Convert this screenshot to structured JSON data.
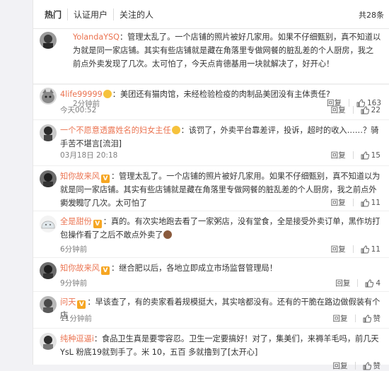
{
  "tabs": [
    {
      "label": "热门",
      "active": true
    },
    {
      "label": "认证用户",
      "active": false
    },
    {
      "label": "关注的人",
      "active": false
    }
  ],
  "total_count": "共28条",
  "comments": [
    {
      "user": "YolandaYSQ",
      "text": "：管理太乱了。一个店铺的照片被好几家用。如果不仔细甄别，真不知道以为就是同一家店铺。其实有些店铺就是藏在角落里专做网餐的脏乱差的个人厨房，我之前点外卖发现了几次。太可怕了，今天点肯德基用一块就解决了，好开心！",
      "time": "2分钟前",
      "reply": "回复",
      "likes": "163"
    },
    {
      "user": "4life99999",
      "text": "：美团还有猫肉馆，未经检验检疫的肉制品美团没有主体责任?",
      "time": "今天00:52",
      "reply": "回复",
      "likes": "22"
    },
    {
      "user": "一个不愿意透露姓名的妇女主任",
      "text": "：该罚了，外卖平台靠差评，投诉，超时的收入……？骑手苦不堪言[流泪]",
      "time": "03月18日 20:18",
      "reply": "回复",
      "likes": "15"
    },
    {
      "user": "知你故来风",
      "text": "：管理太乱了。一个店铺的照片被好几家用。如果不仔细甄别，真不知道以为就是同一家店铺。其实有些店铺就是藏在角落里专做网餐的脏乱差的个人厨房，我之前点外卖发现了几次。太可怕了",
      "time": "9分钟前",
      "reply": "回复",
      "likes": "11"
    },
    {
      "user": "全是甜份",
      "text": "：真的。有次实地跑去看了一家粥店，没有堂食，全是接受外卖订单，黑作坊打包操作看了之后不敢点外卖了",
      "time": "6分钟前",
      "reply": "回复",
      "likes": "11"
    },
    {
      "user": "知你故来风",
      "text": "：继合肥以后，各地立即成立市场监督管理局！",
      "time": "9分钟前",
      "reply": "回复",
      "likes": "4"
    },
    {
      "user": "问天",
      "text": "：早该查了，有的卖家看着规模挺大，其实啥都没有。还有的干脆在路边做假装有个店",
      "time": "11分钟前",
      "reply": "回复",
      "likes": "赞"
    },
    {
      "user": "纯种逗逼i",
      "text": "：食品卫生真是要零容忍。卫生一定要搞好！对了，集美们，来褥羊毛吗，前几天YsL 粉底19就到手了。米 10，五百 多就撸到了[太开心]",
      "time": "",
      "reply": "回复",
      "likes": "赞"
    }
  ],
  "colors": {
    "username": "#eb7350",
    "vip_badge": "#f6a623",
    "background": "#f2f2f5"
  }
}
